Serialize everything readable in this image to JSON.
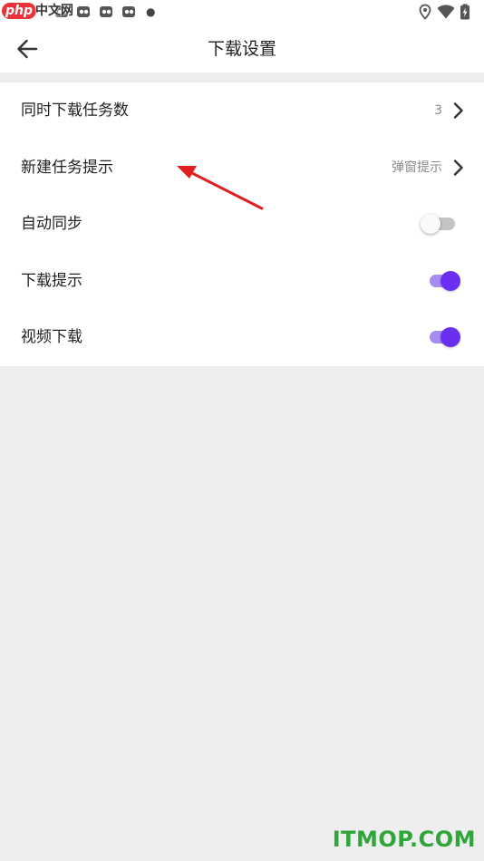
{
  "status_bar": {
    "watermark_php": "php",
    "watermark_cn": "中文网"
  },
  "toolbar": {
    "title": "下载设置"
  },
  "settings": {
    "items": [
      {
        "label": "同时下载任务数",
        "value": "3",
        "control": "chevron"
      },
      {
        "label": "新建任务提示",
        "value": "弹窗提示",
        "control": "chevron"
      },
      {
        "label": "自动同步",
        "control": "toggle",
        "enabled": false
      },
      {
        "label": "下载提示",
        "control": "toggle",
        "enabled": true
      },
      {
        "label": "视频下载",
        "control": "toggle",
        "enabled": true
      }
    ]
  },
  "watermark_bottom": "ITMOP.COM",
  "colors": {
    "accent": "#6a2ff0",
    "accent_track": "#a58cf0",
    "background": "#eeeeee",
    "annotation_arrow": "#e02020",
    "watermark_green": "#2fa53a"
  },
  "icons": [
    "back-arrow-icon",
    "chevron-right-icon",
    "location-icon",
    "wifi-icon",
    "battery-charging-icon",
    "notification-icon"
  ]
}
